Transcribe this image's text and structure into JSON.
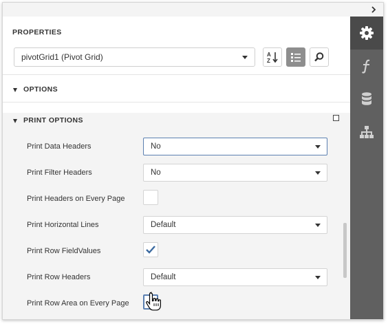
{
  "collapse_icon": "chevron-right-icon",
  "panel": {
    "title": "PROPERTIES",
    "component": "pivotGrid1 (Pivot Grid)"
  },
  "toolbar": {
    "sort_icon": "sort-az-icon",
    "categories_icon": "categorized-icon",
    "search_icon": "search-icon"
  },
  "sections": {
    "options": "OPTIONS",
    "print_options": "PRINT OPTIONS"
  },
  "properties": [
    {
      "label": "Print Data Headers",
      "type": "select",
      "value": "No"
    },
    {
      "label": "Print Filter Headers",
      "type": "select",
      "value": "No"
    },
    {
      "label": "Print Headers on Every Page",
      "type": "checkbox",
      "checked": false
    },
    {
      "label": "Print Horizontal Lines",
      "type": "select",
      "value": "Default"
    },
    {
      "label": "Print Row FieldValues",
      "type": "checkbox",
      "checked": true
    },
    {
      "label": "Print Row Headers",
      "type": "select",
      "value": "Default"
    },
    {
      "label": "Print Row Area on Every Page",
      "type": "checkbox",
      "checked": true
    }
  ],
  "side_tabs": [
    "gear-icon",
    "function-icon",
    "database-icon",
    "hierarchy-icon"
  ],
  "colors": {
    "sidebar": "#606060",
    "sidebar_active": "#4a4a4a",
    "check": "#3b6aa0",
    "focus_border": "#5a7fb0",
    "section_bg": "#f4f4f4"
  }
}
